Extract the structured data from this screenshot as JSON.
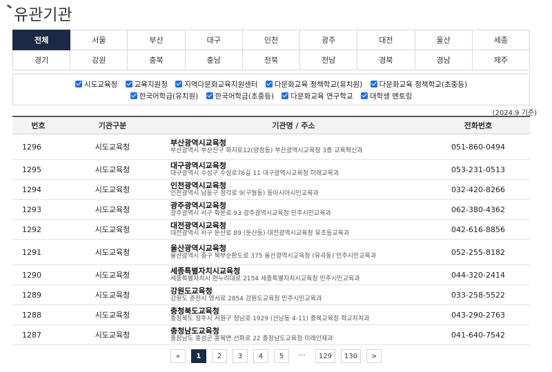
{
  "page_title": "유관기관",
  "regions": [
    [
      "전체",
      "서울",
      "부산",
      "대구",
      "인천",
      "광주",
      "대전",
      "울산",
      "세종"
    ],
    [
      "경기",
      "강원",
      "충북",
      "충남",
      "전북",
      "전남",
      "경북",
      "경남",
      "제주"
    ]
  ],
  "active_region": "전체",
  "filters": {
    "row1": [
      "시도교육청",
      "교육지원청",
      "지역다문화교육지원센터",
      "다문화교육 정책학교(유치원)",
      "다문화교육 정책학교(초중등)"
    ],
    "row2": [
      "한국어학급(유치원)",
      "한국어학급(초중등)",
      "다문화교육 연구학교",
      "대학생 멘토링"
    ]
  },
  "as_of": "(2024.9 기준)",
  "table": {
    "headers": [
      "번호",
      "기관구분",
      "기관명 / 주소",
      "전화번호"
    ],
    "rows": [
      {
        "num": "1296",
        "type": "시도교육청",
        "name": "부산광역시교육청",
        "address": "부산광역시 부산진구 화지로12(양정동) 부산광역시교육청 3층 교육혁신과",
        "phone": "051-860-0494"
      },
      {
        "num": "1295",
        "type": "시도교육청",
        "name": "대구광역시교육청",
        "address": "대구광역시 수성구 수성로76길 11 대구광역시교육청 미래교육과",
        "phone": "053-231-0513"
      },
      {
        "num": "1294",
        "type": "시도교육청",
        "name": "인천광역시교육청",
        "address": "인천광역시 남동구 정각로 9(구월동) 동아시아시민교육과",
        "phone": "032-420-8266"
      },
      {
        "num": "1293",
        "type": "시도교육청",
        "name": "광주광역시교육청",
        "address": "광주광역시 서구 화운로 93 광주광역시교육청 민주시민교육과",
        "phone": "062-380-4362"
      },
      {
        "num": "1292",
        "type": "시도교육청",
        "name": "대전광역시교육청",
        "address": "대전광역시 서구 둔산로 89 (둔산동) 대전광역시교육청 유초등교육과",
        "phone": "042-616-8856"
      },
      {
        "num": "1291",
        "type": "시도교육청",
        "name": "울산광역시교육청",
        "address": "울산광역시 중구 북부순환도로 375 울산광역시교육청 (유곡동) 민주시민교육과",
        "phone": "052-255-8182"
      },
      {
        "num": "1290",
        "type": "시도교육청",
        "name": "세종특별자치시교육청",
        "address": "세종특별자치시 한누리대로 2154 세종특별자치시교육청 민주시민교육과",
        "phone": "044-320-2414"
      },
      {
        "num": "1289",
        "type": "시도교육청",
        "name": "강원도교육청",
        "address": "강원도 춘천시 영서로 2854 강원도교육청 민주시민교육과",
        "phone": "033-258-5522"
      },
      {
        "num": "1288",
        "type": "시도교육청",
        "name": "충청북도교육청",
        "address": "충청북도 청주시 서원구 청남로 1929 (산남동 4-11) 충북교육청 학교자치과",
        "phone": "043-290-2763"
      },
      {
        "num": "1287",
        "type": "시도교육청",
        "name": "충청남도교육청",
        "address": "충청남도 홍성군 홍북면 선화로 22 충청남도교육청 미래인재과",
        "phone": "041-640-7542"
      }
    ]
  },
  "pagination": {
    "prev": "«",
    "pages": [
      "1",
      "2",
      "3",
      "4",
      "5"
    ],
    "ellipsis": "···",
    "last_pages": [
      "129",
      "130"
    ],
    "next": ">",
    "current": "1"
  },
  "colors": {
    "active_bg": "#1b2a45",
    "checkbox": "#1f6fe0"
  }
}
